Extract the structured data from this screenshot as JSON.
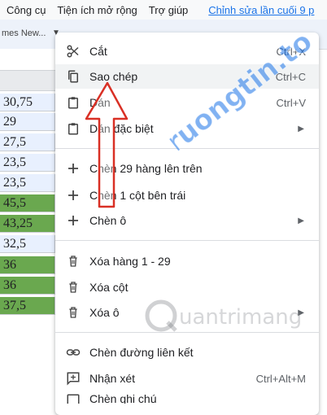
{
  "menubar": {
    "items": [
      "Công cụ",
      "Tiện ích mở rộng",
      "Trợ giúp"
    ],
    "last_edit": "Chỉnh sửa lần cuối 9 p"
  },
  "toolbar": {
    "font": "mes New..."
  },
  "cells": [
    "30,75",
    "29",
    "27,5",
    "23,5",
    "23,5",
    "45,5",
    "43,25",
    "32,5",
    "36",
    "36",
    "37,5"
  ],
  "context_menu": {
    "cut": {
      "label": "Cắt",
      "shortcut": "Ctrl+X"
    },
    "copy": {
      "label": "Sao chép",
      "shortcut": "Ctrl+C"
    },
    "paste": {
      "label": "Dán",
      "shortcut": "Ctrl+V"
    },
    "paste_special": {
      "label": "Dán đặc biệt"
    },
    "insert_rows": {
      "label": "Chèn 29 hàng lên trên"
    },
    "insert_col": {
      "label": "Chèn 1 cột bên trái"
    },
    "insert_cells": {
      "label": "Chèn ô"
    },
    "delete_rows": {
      "label": "Xóa hàng 1 - 29"
    },
    "delete_col": {
      "label": "Xóa cột"
    },
    "delete_cells": {
      "label": "Xóa ô"
    },
    "insert_link": {
      "label": "Chèn đường liên kết"
    },
    "comment": {
      "label": "Nhận xét",
      "shortcut": "Ctrl+Alt+M"
    },
    "insert_note": {
      "label": "Chèn ghi chú"
    }
  },
  "watermarks": {
    "top": "Truongtin.top",
    "bottom": "uantrimang"
  },
  "colors": {
    "green_cell": "#6aa84f",
    "blue_cell": "#e8f0fe",
    "watermark": "#1a73e8",
    "arrow": "#d93025"
  }
}
